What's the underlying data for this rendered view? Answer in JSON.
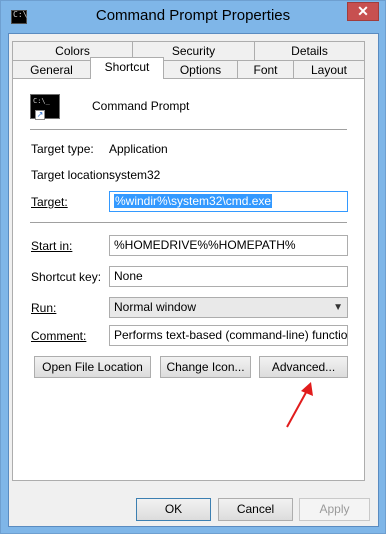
{
  "window": {
    "title": "Command Prompt Properties",
    "close_symbol": "✕"
  },
  "tabs_row1": [
    "Colors",
    "Security",
    "Details"
  ],
  "tabs_row2": [
    "General",
    "Shortcut",
    "Options",
    "Font",
    "Layout"
  ],
  "shortcut": {
    "name": "Command Prompt",
    "target_type_label": "Target type:",
    "target_type_value": "Application",
    "target_location_label": "Target location:",
    "target_location_value": "system32",
    "target_label": "Target:",
    "target_value": "%windir%\\system32\\cmd.exe",
    "start_in_label": "Start in:",
    "start_in_value": "%HOMEDRIVE%%HOMEPATH%",
    "shortcut_key_label": "Shortcut key:",
    "shortcut_key_value": "None",
    "run_label": "Run:",
    "run_value": "Normal window",
    "comment_label": "Comment:",
    "comment_value": "Performs text-based (command-line) functions.",
    "open_file_location": "Open File Location",
    "change_icon": "Change Icon...",
    "advanced": "Advanced..."
  },
  "footer": {
    "ok": "OK",
    "cancel": "Cancel",
    "apply": "Apply"
  },
  "colors": {
    "selection": "#3399ff",
    "annotation_arrow": "#e11c1c",
    "close_button": "#c75050"
  }
}
